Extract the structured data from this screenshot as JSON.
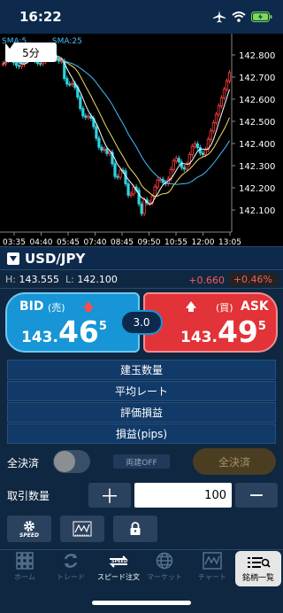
{
  "status": {
    "time": "16:22"
  },
  "chart": {
    "timeframe": "5分",
    "sma_label": "SMA:25",
    "sma_prefix": "SMA:5",
    "y_ticks": [
      "142.800",
      "142.700",
      "142.600",
      "142.500",
      "142.400",
      "142.300",
      "142.200",
      "142.100"
    ],
    "x_ticks": [
      "03:35",
      "04:40",
      "05:45",
      "07:40",
      "08:45",
      "09:50",
      "10:55",
      "12:00",
      "13:05"
    ]
  },
  "symbol": {
    "name": "USD/JPY"
  },
  "hl": {
    "h_label": "H:",
    "high": "143.555",
    "l_label": "L:",
    "low": "142.100",
    "change": "+0.660",
    "change_pct": "+0.46%"
  },
  "bid": {
    "label": "BID",
    "sub": "(売)",
    "small": "143.",
    "big": "46",
    "pip": "5"
  },
  "ask": {
    "label": "ASK",
    "sub": "(買)",
    "small": "143.",
    "big": "49",
    "pip": "5"
  },
  "spread": "3.0",
  "info_rows": [
    "建玉数量",
    "平均レート",
    "評価損益",
    "損益(pips)"
  ],
  "controls": {
    "close_all_label": "全決済",
    "ryodate": "両建OFF",
    "close_all_btn": "全決済",
    "qty_label": "取引数量",
    "qty_value": "100",
    "plus": "＋",
    "minus": "−",
    "speed": "SPEED"
  },
  "tabs": [
    "ホーム",
    "トレード",
    "スピード注文",
    "マーケット",
    "チャート",
    "銘柄一覧"
  ],
  "colors": {
    "bid": "#1795d6",
    "ask": "#e23339",
    "bg": "#0f2741"
  }
}
